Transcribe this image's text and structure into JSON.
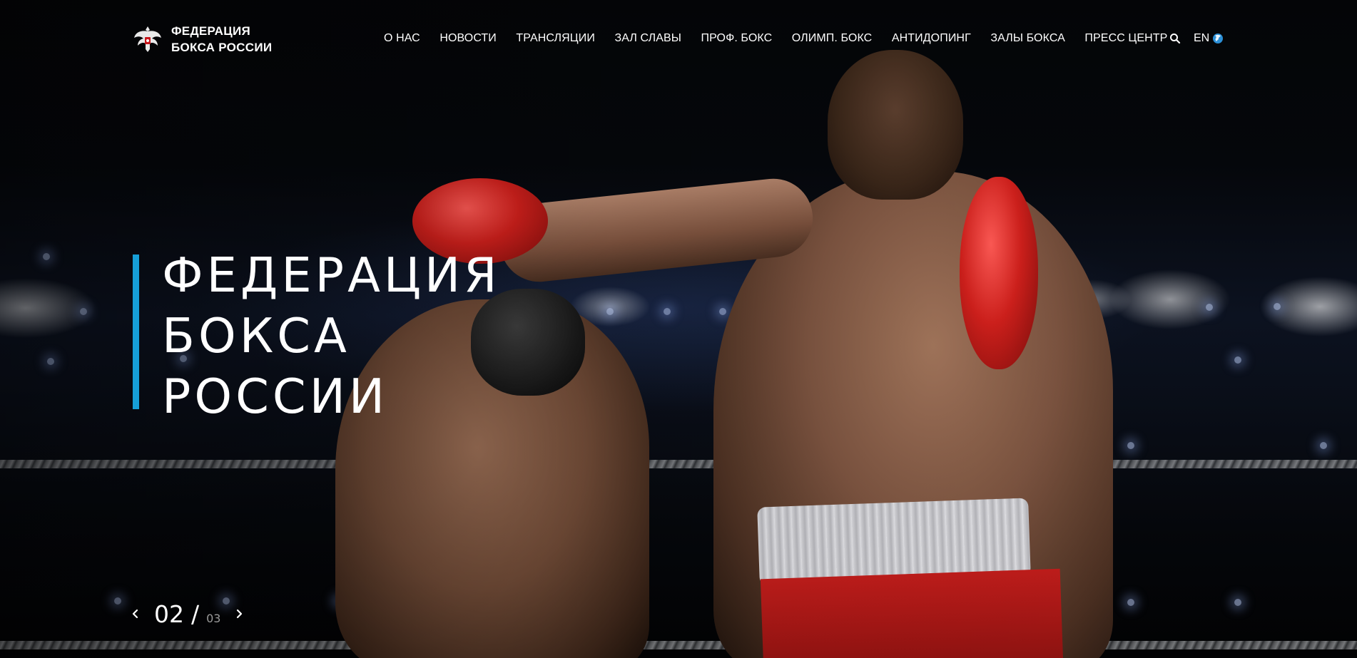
{
  "header": {
    "logo": {
      "line1": "ФЕДЕРАЦИЯ",
      "line2": "БОКСА РОССИИ",
      "emblem_icon": "eagle-emblem-icon"
    },
    "nav": [
      {
        "label": "О НАС"
      },
      {
        "label": "НОВОСТИ"
      },
      {
        "label": "ТРАНСЛЯЦИИ"
      },
      {
        "label": "ЗАЛ СЛАВЫ"
      },
      {
        "label": "ПРОФ. БОКС"
      },
      {
        "label": "ОЛИМП. БОКС"
      },
      {
        "label": "АНТИДОПИНГ"
      },
      {
        "label": "ЗАЛЫ БОКСА"
      },
      {
        "label": "ПРЕСС ЦЕНТР"
      }
    ],
    "search_icon": "search-icon",
    "language": {
      "label": "EN",
      "icon": "globe-icon"
    }
  },
  "hero": {
    "title_lines": [
      "ФЕДЕРАЦИЯ",
      "БОКСА",
      "РОССИИ"
    ],
    "accent_color": "#169fd8",
    "image": "boxing-match-photo"
  },
  "slider": {
    "current": "02",
    "separator": "/",
    "total": "03",
    "prev_icon": "chevron-left-icon",
    "next_icon": "chevron-right-icon"
  },
  "colors": {
    "background": "#000000",
    "text": "#ffffff",
    "muted": "#9a9a9a",
    "accent": "#169fd8",
    "glove_red": "#d0201c"
  }
}
